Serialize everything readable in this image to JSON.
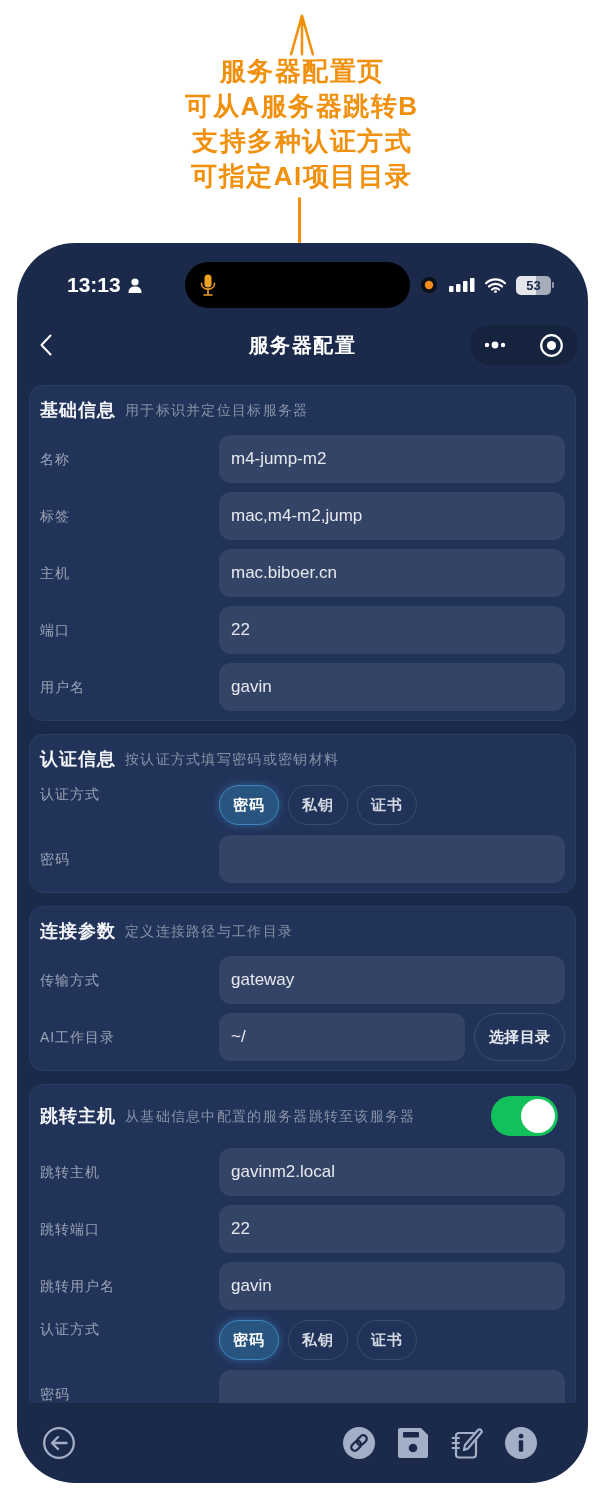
{
  "annotation": {
    "lines": [
      "服务器配置页",
      "可从A服务器跳转B",
      "支持多种认证方式",
      "可指定AI项目目录"
    ]
  },
  "status_bar": {
    "time": "13:13",
    "battery": "53"
  },
  "nav_bar": {
    "title": "服务器配置"
  },
  "sections": [
    {
      "title": "基础信息",
      "subtitle": "用于标识并定位目标服务器",
      "fields": [
        {
          "kind": "input",
          "label": "名称",
          "value": "m4-jump-m2"
        },
        {
          "kind": "input",
          "label": "标签",
          "value": "mac,m4-m2,jump"
        },
        {
          "kind": "input",
          "label": "主机",
          "value": "mac.biboer.cn"
        },
        {
          "kind": "input",
          "label": "端口",
          "value": "22"
        },
        {
          "kind": "input",
          "label": "用户名",
          "value": "gavin"
        }
      ]
    },
    {
      "title": "认证信息",
      "subtitle": "按认证方式填写密码或密钥材料",
      "fields": [
        {
          "kind": "choice",
          "label": "认证方式",
          "options": [
            {
              "label": "密码",
              "selected": true
            },
            {
              "label": "私钥",
              "selected": false
            },
            {
              "label": "证书",
              "selected": false
            }
          ]
        },
        {
          "kind": "input",
          "label": "密码"
        }
      ]
    },
    {
      "title": "连接参数",
      "subtitle": "定义连接路径与工作目录",
      "fields": [
        {
          "kind": "input",
          "label": "传输方式",
          "value": "gateway"
        },
        {
          "kind": "input_button",
          "label": "AI工作目录",
          "value": "~/",
          "button": "选择目录"
        }
      ]
    },
    {
      "title": "跳转主机",
      "subtitle": "从基础信息中配置的服务器跳转至该服务器",
      "toggle": {
        "on": true
      },
      "fields": [
        {
          "kind": "input",
          "label": "跳转主机",
          "value": "gavinm2.local"
        },
        {
          "kind": "input",
          "label": "跳转端口",
          "value": "22"
        },
        {
          "kind": "input",
          "label": "跳转用户名",
          "value": "gavin"
        },
        {
          "kind": "choice",
          "label": "认证方式",
          "options": [
            {
              "label": "密码",
              "selected": true
            },
            {
              "label": "私钥",
              "selected": false
            },
            {
              "label": "证书",
              "selected": false
            }
          ]
        },
        {
          "kind": "input",
          "label": "密码"
        }
      ]
    }
  ]
}
